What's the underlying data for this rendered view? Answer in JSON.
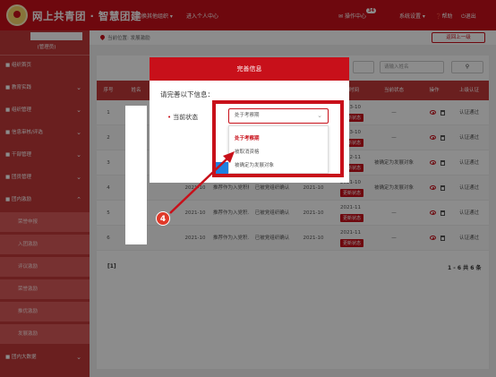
{
  "header": {
    "title": "网上共青团 · 智慧团建",
    "switch_org": "切换其他组织 ▾",
    "personal_center": "进入个人中心",
    "notifications_label": "操作中心",
    "notifications_count": "34",
    "settings_label": "系统设置 ▾",
    "help_label": "帮助",
    "logout_label": "退出"
  },
  "sidebar": {
    "role": "(管理员)",
    "items": [
      {
        "label": "■ 组织首页"
      },
      {
        "label": "■ 教育实践"
      },
      {
        "label": "■ 组织管理"
      },
      {
        "label": "■ 信息审核/评选"
      },
      {
        "label": "■ 干部管理"
      },
      {
        "label": "■ 团员管理"
      },
      {
        "label": "■ 团内激励"
      }
    ],
    "subitems": [
      {
        "label": "荣誉申报"
      },
      {
        "label": "入团激励"
      },
      {
        "label": "评议激励"
      },
      {
        "label": "荣誉激励"
      },
      {
        "label": "推优激励"
      },
      {
        "label": "发展激励"
      }
    ],
    "bottom_item": "■ 团内大数据"
  },
  "breadcrumb": "当前位置: 发展激励",
  "back_button": "返回上一级",
  "search": {
    "placeholder": "请输入姓名",
    "button_icon": "search-icon"
  },
  "table": {
    "columns": [
      "序号",
      "姓名",
      "",
      "",
      "",
      "认定时间",
      "当前状态",
      "操作",
      "上级认证"
    ],
    "rows": [
      {
        "no": "1",
        "date": "2023-10\n更新状态",
        "status": "—",
        "cert": "认证通过"
      },
      {
        "no": "2",
        "date": "2023-10\n更新状态",
        "status": "—",
        "cert": "认证通过"
      },
      {
        "no": "3",
        "date": "2022-11\n更新状态",
        "status": "被确定为发展对象",
        "cert": "认证通过"
      },
      {
        "no": "4",
        "period": "2021-10",
        "type": "推荐作为入党积极分子",
        "result": "已被党组织确认",
        "period2": "2021-10",
        "date": "2021-10\n更新状态",
        "status": "被确定为发展对象",
        "cert": "认证通过"
      },
      {
        "no": "5",
        "period": "2021-10",
        "type": "推荐作为入党积...",
        "result": "已被党组织确认",
        "period2": "2021-10",
        "date": "2021-11\n更新状态",
        "status": "—",
        "cert": "认证通过"
      },
      {
        "no": "6",
        "period": "2021-10",
        "type": "推荐作为入党积...",
        "result": "已被党组织确认",
        "period2": "2021-10",
        "date": "2021-11\n更新状态",
        "status": "—",
        "cert": "认证通过"
      }
    ],
    "update_btn": "更新状态",
    "page": "[1]",
    "total": "1 - 6  共 6 条"
  },
  "dialog": {
    "title": "完善信息",
    "prompt": "请完善以下信息：",
    "field_label": "当前状态",
    "select_value": "处于考察期",
    "options": [
      "处于考察期",
      "被取消资格",
      "被确定为发展对象"
    ]
  },
  "annotation": {
    "step": "4"
  },
  "colors": {
    "brand_red": "#c8101a",
    "sidebar": "#c23a3a",
    "accent_blue": "#1e7fe0"
  }
}
